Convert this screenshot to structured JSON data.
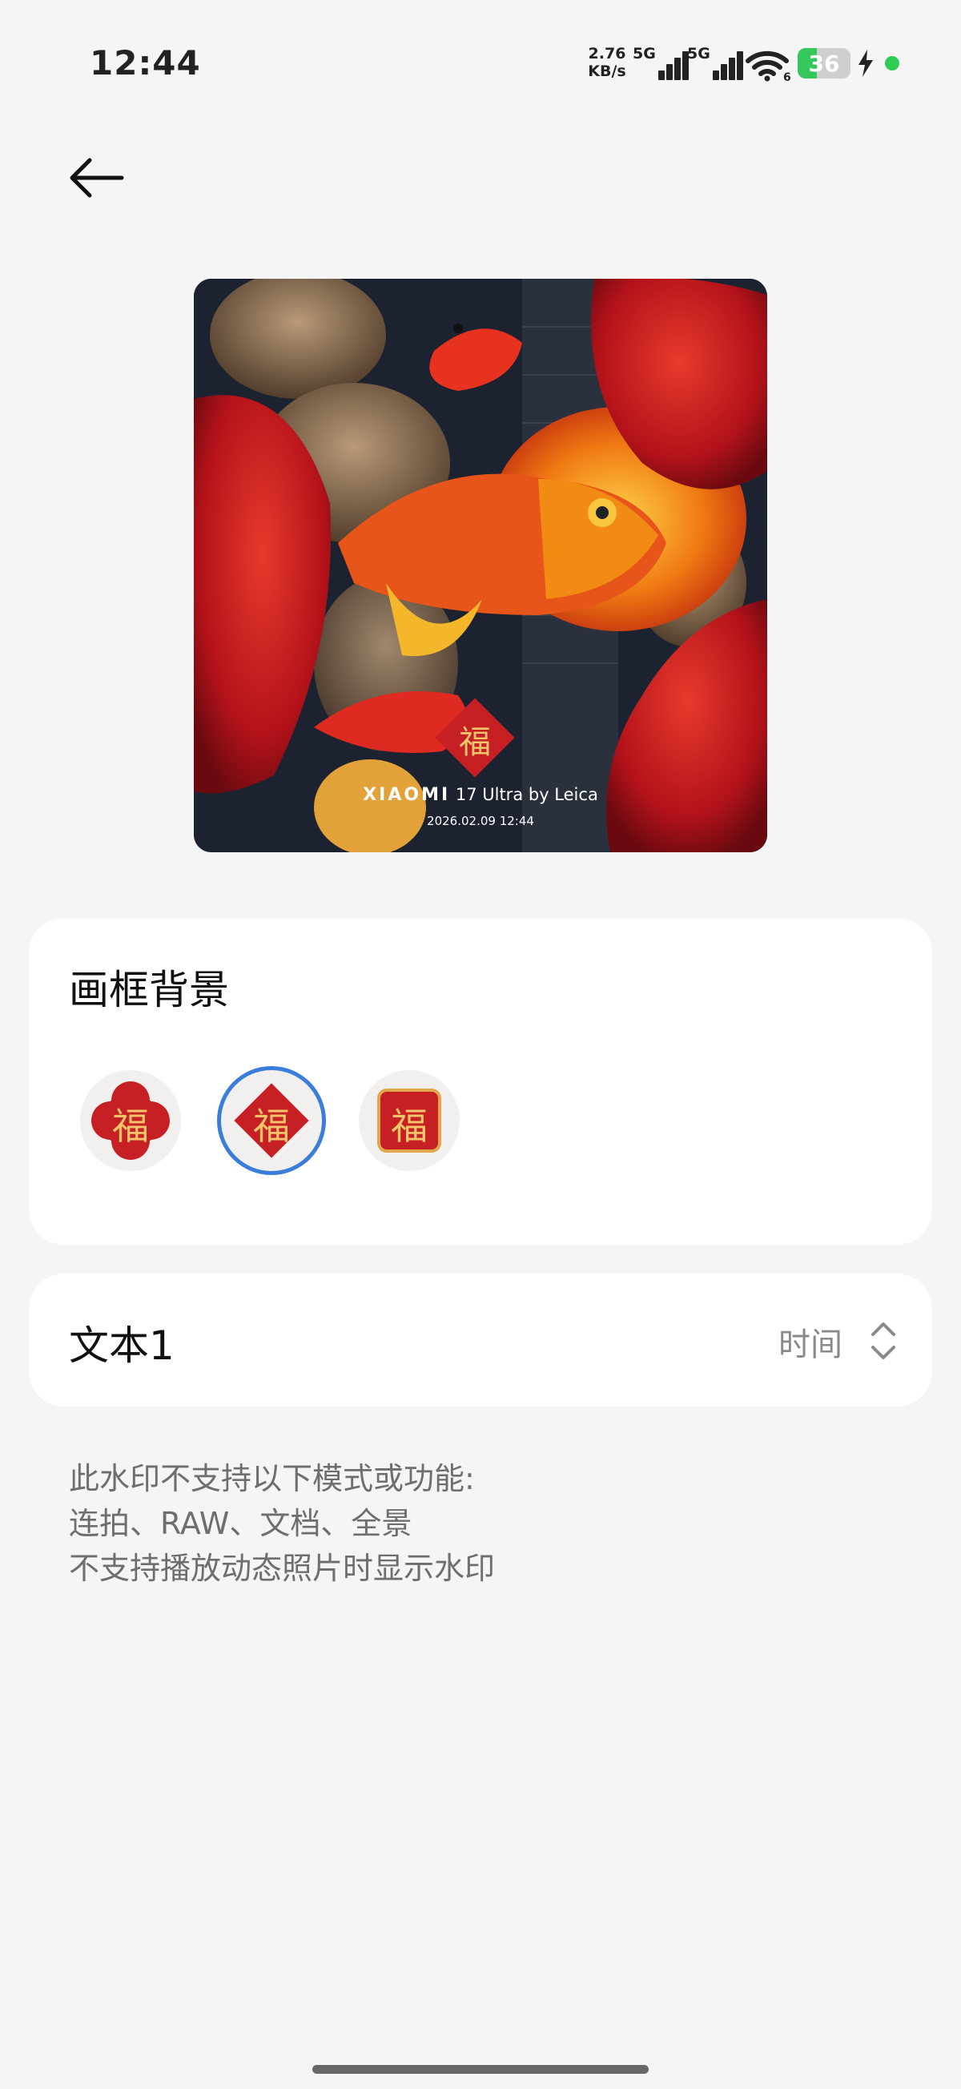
{
  "status_bar": {
    "time": "12:44",
    "net_speed_value": "2.76",
    "net_speed_unit": "KB/s",
    "signal1_label": "5G",
    "signal2_label": "5G",
    "wifi_badge": "6",
    "battery_level": "36",
    "battery_color": "#34c759",
    "icons": [
      "signal-icon",
      "wifi-icon",
      "battery-icon",
      "charging-bolt-icon",
      "privacy-dot-icon"
    ]
  },
  "header": {
    "back_icon": "back-arrow-icon"
  },
  "preview": {
    "watermark_brand": "XIAOMI",
    "watermark_model": "17 Ultra",
    "watermark_by": "by Leica",
    "watermark_date": "2026.02.09 12:44",
    "fu_char": "福"
  },
  "frame_background": {
    "title": "画框背景",
    "options": [
      {
        "char": "福",
        "shape": "quatrefoil",
        "selected": false
      },
      {
        "char": "福",
        "shape": "diamond",
        "selected": true
      },
      {
        "char": "福",
        "shape": "square",
        "selected": false
      }
    ],
    "selected_color": "#3b7ed8"
  },
  "text1": {
    "label": "文本1",
    "value": "时间"
  },
  "notes": {
    "line1": "此水印不支持以下模式或功能:",
    "line2": "连拍、RAW、文档、全景",
    "line3": "不支持播放动态照片时显示水印"
  }
}
